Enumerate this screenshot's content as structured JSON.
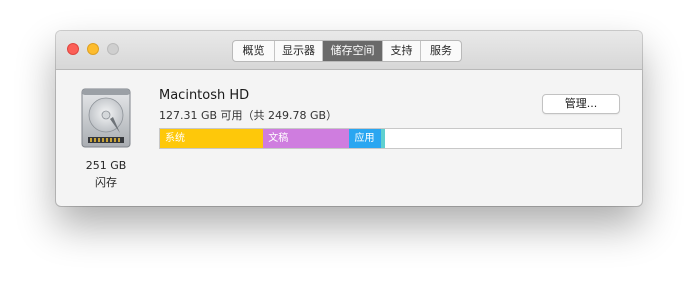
{
  "window": {
    "tabs": [
      {
        "label": "概览",
        "active": false
      },
      {
        "label": "显示器",
        "active": false
      },
      {
        "label": "储存空间",
        "active": true
      },
      {
        "label": "支持",
        "active": false
      },
      {
        "label": "服务",
        "active": false
      }
    ]
  },
  "disk": {
    "icon": "hard-drive-icon",
    "size": "251 GB",
    "type": "闪存"
  },
  "volume": {
    "name": "Macintosh HD",
    "available": "127.31 GB 可用（共 249.78 GB）",
    "manage_label": "管理..."
  },
  "storage_bar": {
    "segments": [
      {
        "label": "系统",
        "fraction": 0.224,
        "color": "#fec80a"
      },
      {
        "label": "文稿",
        "fraction": 0.187,
        "color": "#cf7ddf"
      },
      {
        "label": "应用",
        "fraction": 0.069,
        "color": "#2aa6f1"
      },
      {
        "label": "",
        "fraction": 0.008,
        "color": "#5fd0cf"
      }
    ]
  }
}
